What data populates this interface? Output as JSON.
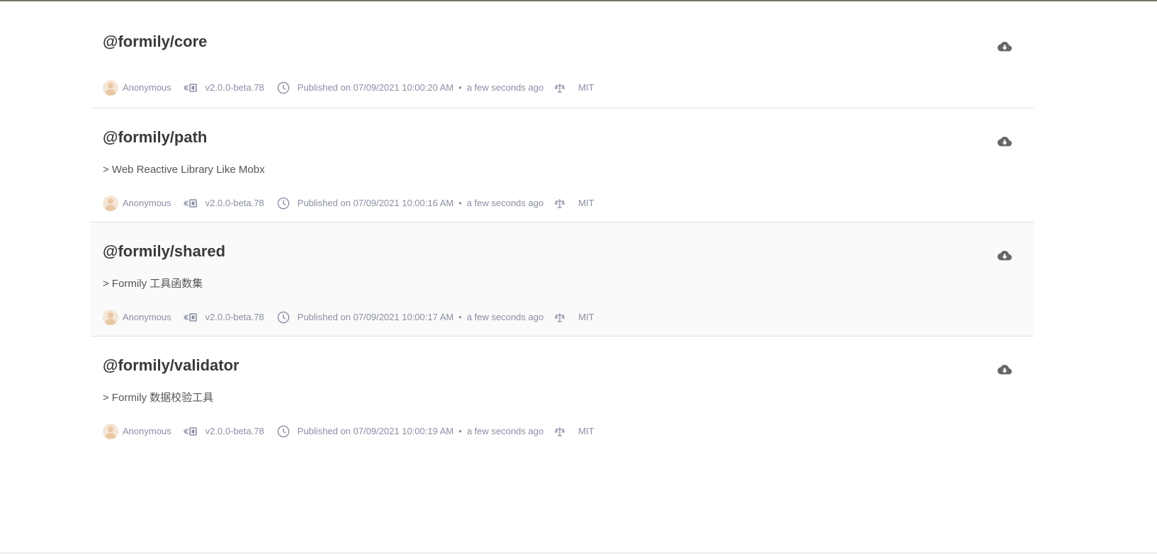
{
  "packages": [
    {
      "name": "@formily/core",
      "description": "",
      "author": "Anonymous",
      "version": "v2.0.0-beta.78",
      "published": "Published on 07/09/2021 10:00:20 AM",
      "separator": "•",
      "relative_time": "a few seconds ago",
      "license": "MIT"
    },
    {
      "name": "@formily/path",
      "description": "> Web Reactive Library Like Mobx",
      "author": "Anonymous",
      "version": "v2.0.0-beta.78",
      "published": "Published on 07/09/2021 10:00:16 AM",
      "separator": "•",
      "relative_time": "a few seconds ago",
      "license": "MIT"
    },
    {
      "name": "@formily/shared",
      "description": "> Formily 工具函数集",
      "author": "Anonymous",
      "version": "v2.0.0-beta.78",
      "published": "Published on 07/09/2021 10:00:17 AM",
      "separator": "•",
      "relative_time": "a few seconds ago",
      "license": "MIT"
    },
    {
      "name": "@formily/validator",
      "description": "> Formily 数据校验工具",
      "author": "Anonymous",
      "version": "v2.0.0-beta.78",
      "published": "Published on 07/09/2021 10:00:19 AM",
      "separator": "•",
      "relative_time": "a few seconds ago",
      "license": "MIT"
    }
  ],
  "icons": {
    "download": "cloud-download-icon",
    "avatar": "avatar",
    "version": "version-tag-icon",
    "published": "clock-icon",
    "license": "scale-icon"
  },
  "colors": {
    "title": "#3a3a3a",
    "meta": "#8a8fa3",
    "hover_row": "#fafafa",
    "divider": "#e0e0e0",
    "download_icon": "#666666"
  }
}
